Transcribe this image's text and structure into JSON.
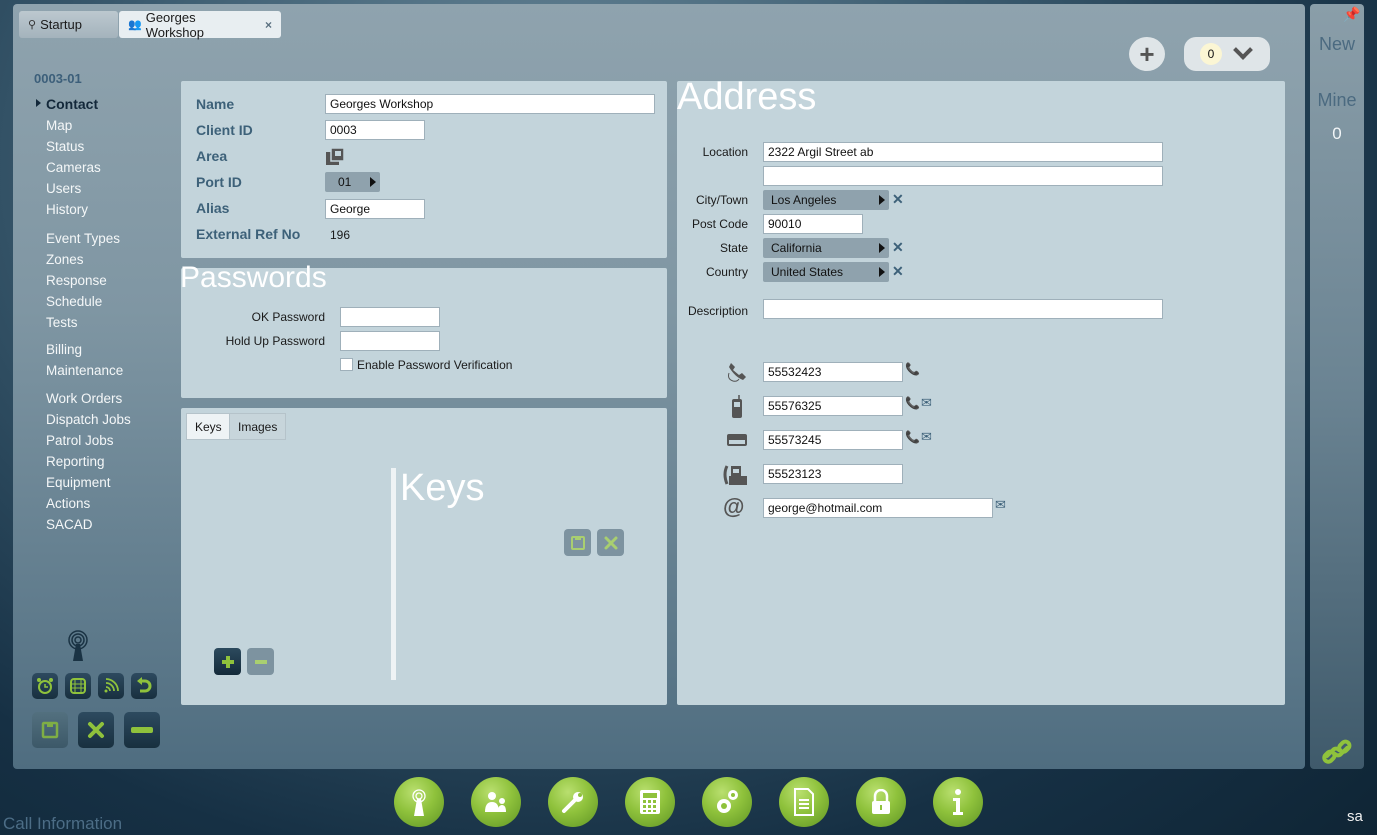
{
  "tabs": [
    {
      "label": "Startup",
      "icon": "antenna-icon",
      "active": false
    },
    {
      "label": "Georges Workshop",
      "icon": "users-icon",
      "active": true,
      "close": "×"
    }
  ],
  "top_controls": {
    "add_label": "+",
    "counter_value": "0"
  },
  "right_panel": {
    "new_label": "New",
    "mine_label": "Mine",
    "mine_count": "0"
  },
  "sidebar": {
    "account_id": "0003-01",
    "items": [
      {
        "label": "Contact",
        "active": true
      },
      {
        "label": "Map"
      },
      {
        "label": "Status"
      },
      {
        "label": "Cameras"
      },
      {
        "label": "Users"
      },
      {
        "label": "History"
      },
      {
        "label": "Event Types"
      },
      {
        "label": "Zones"
      },
      {
        "label": "Response"
      },
      {
        "label": "Schedule"
      },
      {
        "label": "Tests"
      },
      {
        "label": "Billing"
      },
      {
        "label": "Maintenance"
      },
      {
        "label": "Work Orders"
      },
      {
        "label": "Dispatch Jobs"
      },
      {
        "label": "Patrol Jobs"
      },
      {
        "label": "Reporting"
      },
      {
        "label": "Equipment"
      },
      {
        "label": "Actions"
      },
      {
        "label": "SACAD"
      }
    ]
  },
  "details": {
    "name_label": "Name",
    "name_value": "Georges Workshop",
    "client_id_label": "Client ID",
    "client_id_value": "0003",
    "area_label": "Area",
    "port_id_label": "Port ID",
    "port_id_value": "01",
    "alias_label": "Alias",
    "alias_value": "George",
    "ext_ref_label": "External Ref No",
    "ext_ref_value": "196"
  },
  "passwords": {
    "title": "Passwords",
    "ok_label": "OK Password",
    "ok_value": "",
    "holdup_label": "Hold Up Password",
    "holdup_value": "",
    "verify_label": "Enable Password Verification",
    "verify_checked": false
  },
  "keys_panel": {
    "tabs": [
      {
        "label": "Keys",
        "active": true
      },
      {
        "label": "Images",
        "active": false
      }
    ],
    "title": "Keys"
  },
  "address": {
    "title": "Address",
    "location_label": "Location",
    "location_value": "2322 Argil Street ab",
    "location2_value": "",
    "city_label": "City/Town",
    "city_value": "Los Angeles",
    "postcode_label": "Post Code",
    "postcode_value": "90010",
    "state_label": "State",
    "state_value": "California",
    "country_label": "Country",
    "country_value": "United States",
    "description_label": "Description",
    "description_value": ""
  },
  "contacts": [
    {
      "type": "landline",
      "value": "55532423",
      "call": true,
      "sms": false
    },
    {
      "type": "mobile",
      "value": "55576325",
      "call": true,
      "sms": true
    },
    {
      "type": "pager",
      "value": "55573245",
      "call": true,
      "sms": true
    },
    {
      "type": "fax",
      "value": "55523123",
      "call": false,
      "sms": false
    },
    {
      "type": "email",
      "value": "george@hotmail.com",
      "call": false,
      "sms": true
    }
  ],
  "footer": {
    "call_info": "Call Information",
    "user": "sa",
    "dock": [
      "antenna-icon",
      "users-icon",
      "wrench-icon",
      "calculator-icon",
      "gears-icon",
      "document-icon",
      "lock-icon",
      "info-icon"
    ]
  },
  "colors": {
    "accent_green": "#8fc23c",
    "label_blue": "#3d6179",
    "card_bg": "#c3d4db"
  }
}
